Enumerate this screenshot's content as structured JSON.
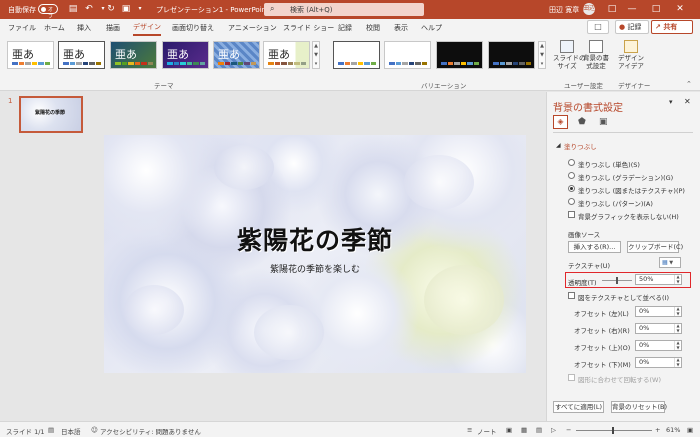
{
  "titlebar": {
    "autosave_label": "自動保存",
    "autosave_state": "オフ",
    "doc_title": "プレゼンテーション1 - PowerPoint",
    "search_placeholder": "検索 (Alt+Q)",
    "user_name": "田辺 寛章",
    "avatar_initials": "田辺"
  },
  "menu": {
    "tabs": [
      "ファイル",
      "ホーム",
      "挿入",
      "描画",
      "デザイン",
      "画面切り替え",
      "アニメーション",
      "スライド ショー",
      "記録",
      "校閲",
      "表示",
      "ヘルプ"
    ],
    "active_tab": "デザイン",
    "record_label": "記録",
    "share_label": "共有"
  },
  "ribbon": {
    "theme_sample_text": "亜あ",
    "themes_group_label": "テーマ",
    "variations_group_label": "バリエーション",
    "slide_size_label": "スライドの\nサイズ",
    "bg_format_label": "背景の書\n式設定",
    "user_settings_group_label": "ユーザー設定",
    "designer_label": "デザイン\nアイデア",
    "designer_group_label": "デザイナー"
  },
  "thumbnails": {
    "slide_number": "1",
    "thumb_title": "紫陽花の季節"
  },
  "slide": {
    "title": "紫陽花の季節",
    "subtitle": "紫陽花の季節を楽しむ"
  },
  "format_pane": {
    "title": "背景の書式設定",
    "section_fill": "塗りつぶし",
    "fill_options": [
      "塗りつぶし (単色)(S)",
      "塗りつぶし (グラデーション)(G)",
      "塗りつぶし (図またはテクスチャ)(P)",
      "塗りつぶし (パターン)(A)"
    ],
    "selected_fill_option": 2,
    "hide_bg_graphics": "背景グラフィックを表示しない(H)",
    "picture_source_label": "画像ソース",
    "insert_button": "挿入する(R)...",
    "clipboard_button": "クリップボード(C)",
    "texture_label": "テクスチャ(U)",
    "transparency_label": "透明度(T)",
    "transparency_value": "50%",
    "transparency_fraction": 0.5,
    "tile_checkbox": "図をテクスチャとして並べる(I)",
    "offsets": [
      {
        "label": "オフセット (左)(L)",
        "value": "0%"
      },
      {
        "label": "オフセット (右)(R)",
        "value": "0%"
      },
      {
        "label": "オフセット (上)(O)",
        "value": "0%"
      },
      {
        "label": "オフセット (下)(M)",
        "value": "0%"
      }
    ],
    "rotate_with_shape": "図形に合わせて回転する(W)",
    "apply_all_button": "すべてに適用(L)",
    "reset_button": "背景のリセット(B)"
  },
  "statusbar": {
    "slide_counter": "スライド 1/1",
    "language": "日本語",
    "accessibility": "アクセシビリティ: 問題ありません",
    "notes": "ノート",
    "zoom": "61%"
  },
  "colors": {
    "accent": "#b7472a",
    "highlight_box": "#e0272b"
  }
}
